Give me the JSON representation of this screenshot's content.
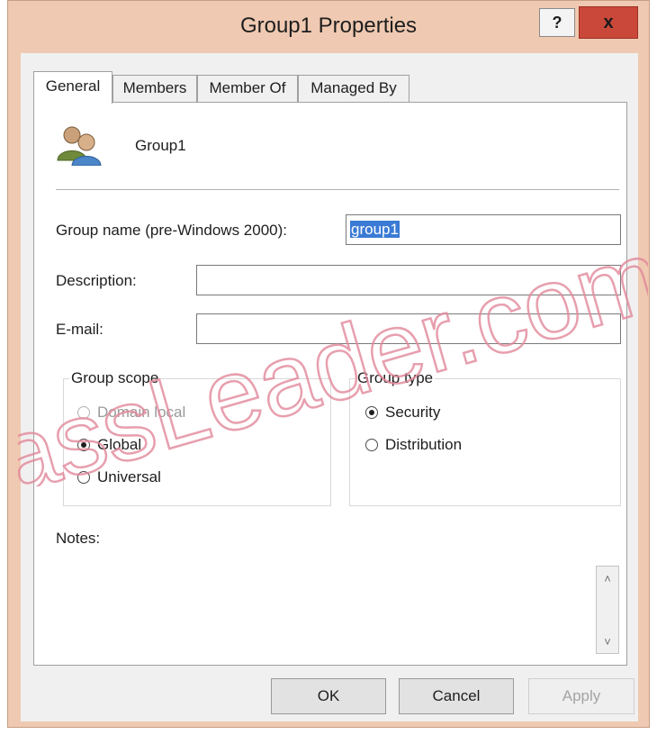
{
  "window": {
    "title": "Group1 Properties",
    "help_label": "?",
    "close_label": "x"
  },
  "tabs": [
    {
      "label": "General",
      "active": true
    },
    {
      "label": "Members",
      "active": false
    },
    {
      "label": "Member Of",
      "active": false
    },
    {
      "label": "Managed By",
      "active": false
    }
  ],
  "general": {
    "group_display_name": "Group1",
    "pre_win2000_label": "Group name (pre-Windows 2000):",
    "pre_win2000_value": "group1",
    "description_label": "Description:",
    "description_value": "",
    "email_label": "E-mail:",
    "email_value": "",
    "scope": {
      "legend": "Group scope",
      "options": [
        {
          "label": "Domain local",
          "selected": false,
          "enabled": false
        },
        {
          "label": "Global",
          "selected": true,
          "enabled": true
        },
        {
          "label": "Universal",
          "selected": false,
          "enabled": true
        }
      ]
    },
    "type": {
      "legend": "Group type",
      "options": [
        {
          "label": "Security",
          "selected": true
        },
        {
          "label": "Distribution",
          "selected": false
        }
      ]
    },
    "notes_label": "Notes:",
    "notes_value": ""
  },
  "buttons": {
    "ok": "OK",
    "cancel": "Cancel",
    "apply": "Apply"
  },
  "watermark": {
    "text": "assLeader.com",
    "color": "#e2889a"
  },
  "colors": {
    "titlebar": "#efc9b1",
    "close": "#c9483a",
    "selection": "#3a7bd5",
    "dialog": "#f0f0f0"
  }
}
